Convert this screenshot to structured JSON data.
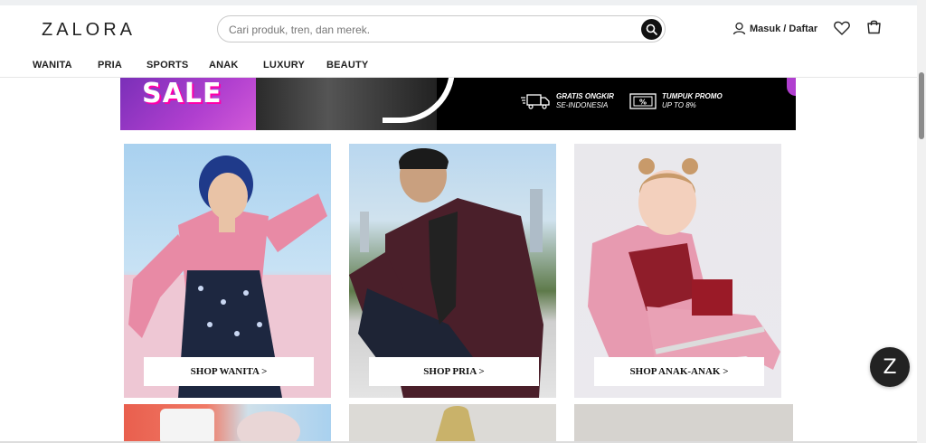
{
  "header": {
    "logo": "ZALORA",
    "search_placeholder": "Cari produk, tren, dan merek.",
    "account_label": "Masuk / Daftar"
  },
  "nav": [
    "WANITA",
    "PRIA",
    "SPORTS",
    "ANAK",
    "LUXURY",
    "BEAUTY"
  ],
  "banner": {
    "sale_text": "SALE",
    "promo1_line1": "GRATIS ONGKIR",
    "promo1_line2": "SE-INDONESIA",
    "promo2_line1": "TUMPUK PROMO",
    "promo2_line2": "UP TO 8%"
  },
  "categories": [
    {
      "label": "SHOP WANITA >"
    },
    {
      "label": "SHOP PRIA >"
    },
    {
      "label": "SHOP ANAK-ANAK >"
    }
  ],
  "chat": {
    "icon_letter": "Z"
  },
  "icons": {
    "search": "search-icon",
    "account": "user-icon",
    "wishlist": "heart-icon",
    "bag": "shopping-bag-icon"
  },
  "colors": {
    "brand": "#222222",
    "banner_purple": "#b03fcf",
    "banner_bg": "#000000"
  }
}
